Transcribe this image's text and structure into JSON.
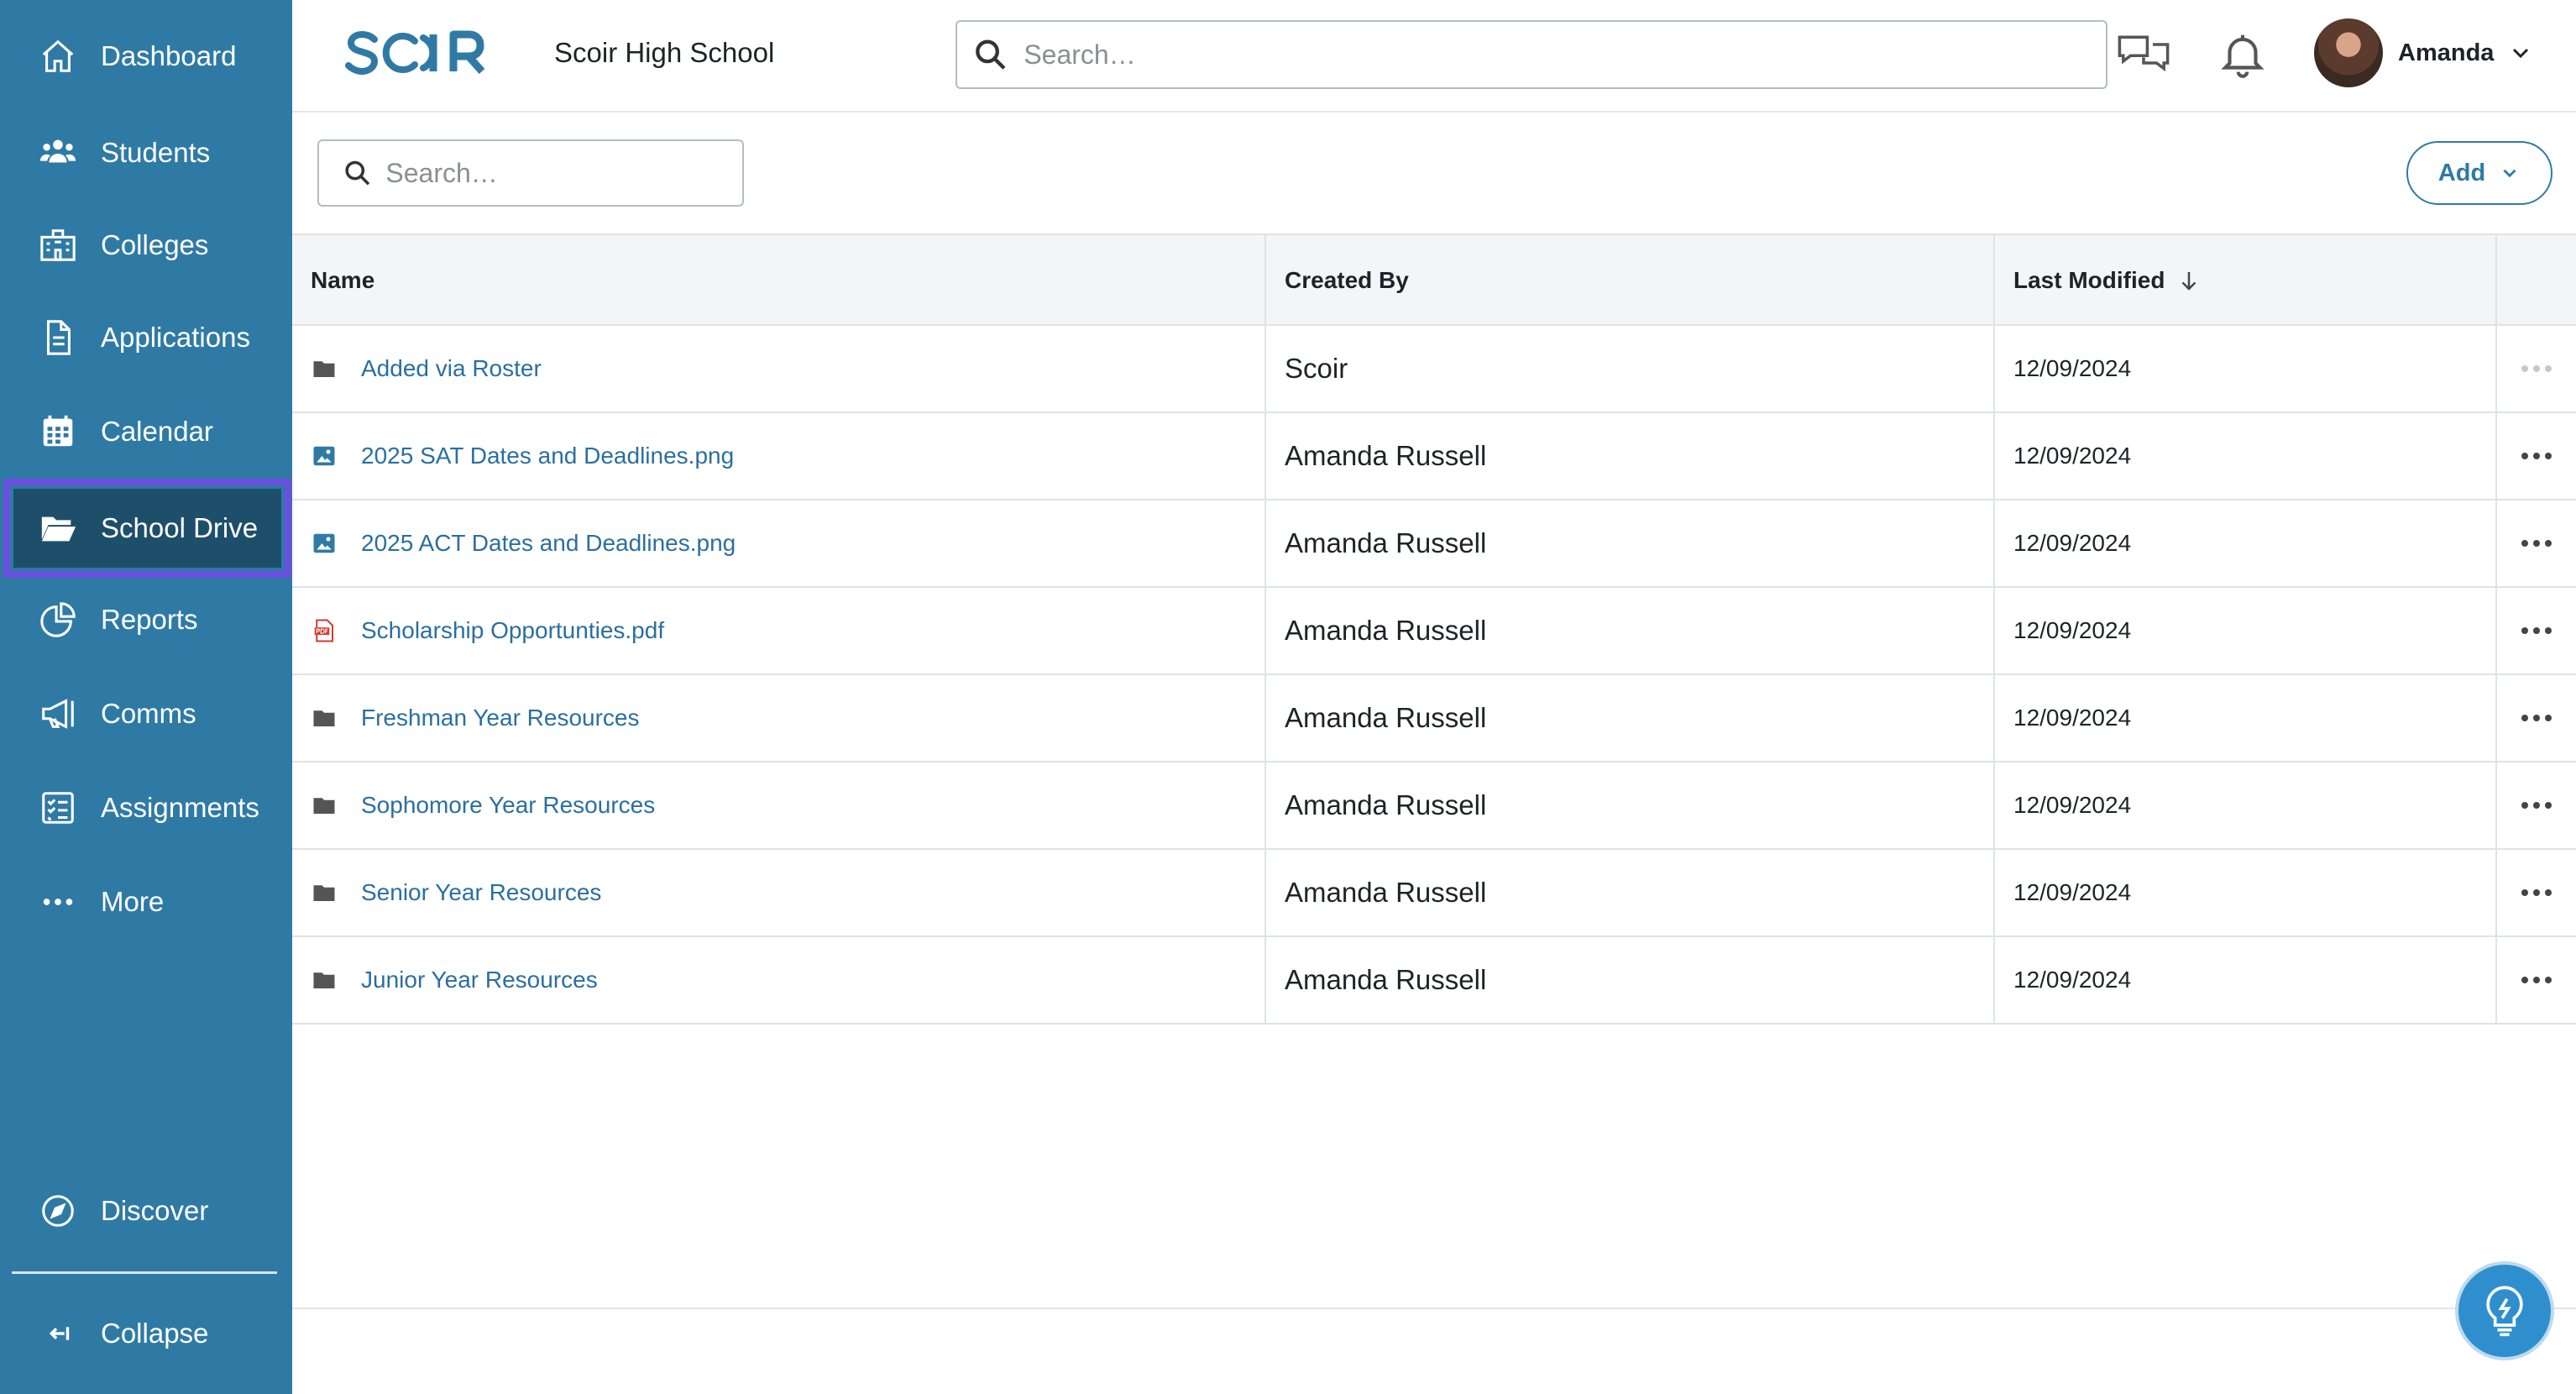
{
  "sidebar": {
    "items": [
      {
        "label": "Dashboard",
        "icon": "house-icon"
      },
      {
        "label": "Students",
        "icon": "users-icon"
      },
      {
        "label": "Colleges",
        "icon": "building-icon"
      },
      {
        "label": "Applications",
        "icon": "document-icon"
      },
      {
        "label": "Calendar",
        "icon": "calendar-icon"
      },
      {
        "label": "School Drive",
        "icon": "folder-open-icon",
        "active": true
      },
      {
        "label": "Reports",
        "icon": "pie-chart-icon"
      },
      {
        "label": "Comms",
        "icon": "megaphone-icon"
      },
      {
        "label": "Assignments",
        "icon": "checklist-icon"
      },
      {
        "label": "More",
        "icon": "ellipsis-icon"
      }
    ],
    "discover": "Discover",
    "collapse": "Collapse"
  },
  "header": {
    "logo_text": "SCOIR",
    "school_name": "Scoir High School",
    "search_placeholder": "Search…",
    "user_name": "Amanda"
  },
  "toolbar": {
    "search_placeholder": "Search…",
    "add_label": "Add"
  },
  "table": {
    "columns": [
      "Name",
      "Created By",
      "Last Modified"
    ],
    "sort_column": "Last Modified",
    "sort_direction": "descending",
    "rows": [
      {
        "type": "folder",
        "name": "Added via Roster",
        "created_by": "Scoir",
        "modified": "12/09/2024"
      },
      {
        "type": "image",
        "name": "2025 SAT Dates and Deadlines.png",
        "created_by": "Amanda Russell",
        "modified": "12/09/2024"
      },
      {
        "type": "image",
        "name": "2025 ACT Dates and Deadlines.png",
        "created_by": "Amanda Russell",
        "modified": "12/09/2024"
      },
      {
        "type": "pdf",
        "name": "Scholarship Opportunties.pdf",
        "created_by": "Amanda Russell",
        "modified": "12/09/2024"
      },
      {
        "type": "folder",
        "name": "Freshman Year Resources",
        "created_by": "Amanda Russell",
        "modified": "12/09/2024"
      },
      {
        "type": "folder",
        "name": "Sophomore Year Resources",
        "created_by": "Amanda Russell",
        "modified": "12/09/2024"
      },
      {
        "type": "folder",
        "name": "Senior Year Resources",
        "created_by": "Amanda Russell",
        "modified": "12/09/2024"
      },
      {
        "type": "folder",
        "name": "Junior Year Resources",
        "created_by": "Amanda Russell",
        "modified": "12/09/2024"
      }
    ]
  },
  "colors": {
    "sidebar_bg": "#2f7aa5",
    "active_bg": "#1d4f6b",
    "active_outline": "#6b4fe0",
    "link": "#2a6fa0",
    "help_button": "#2f8fce"
  }
}
